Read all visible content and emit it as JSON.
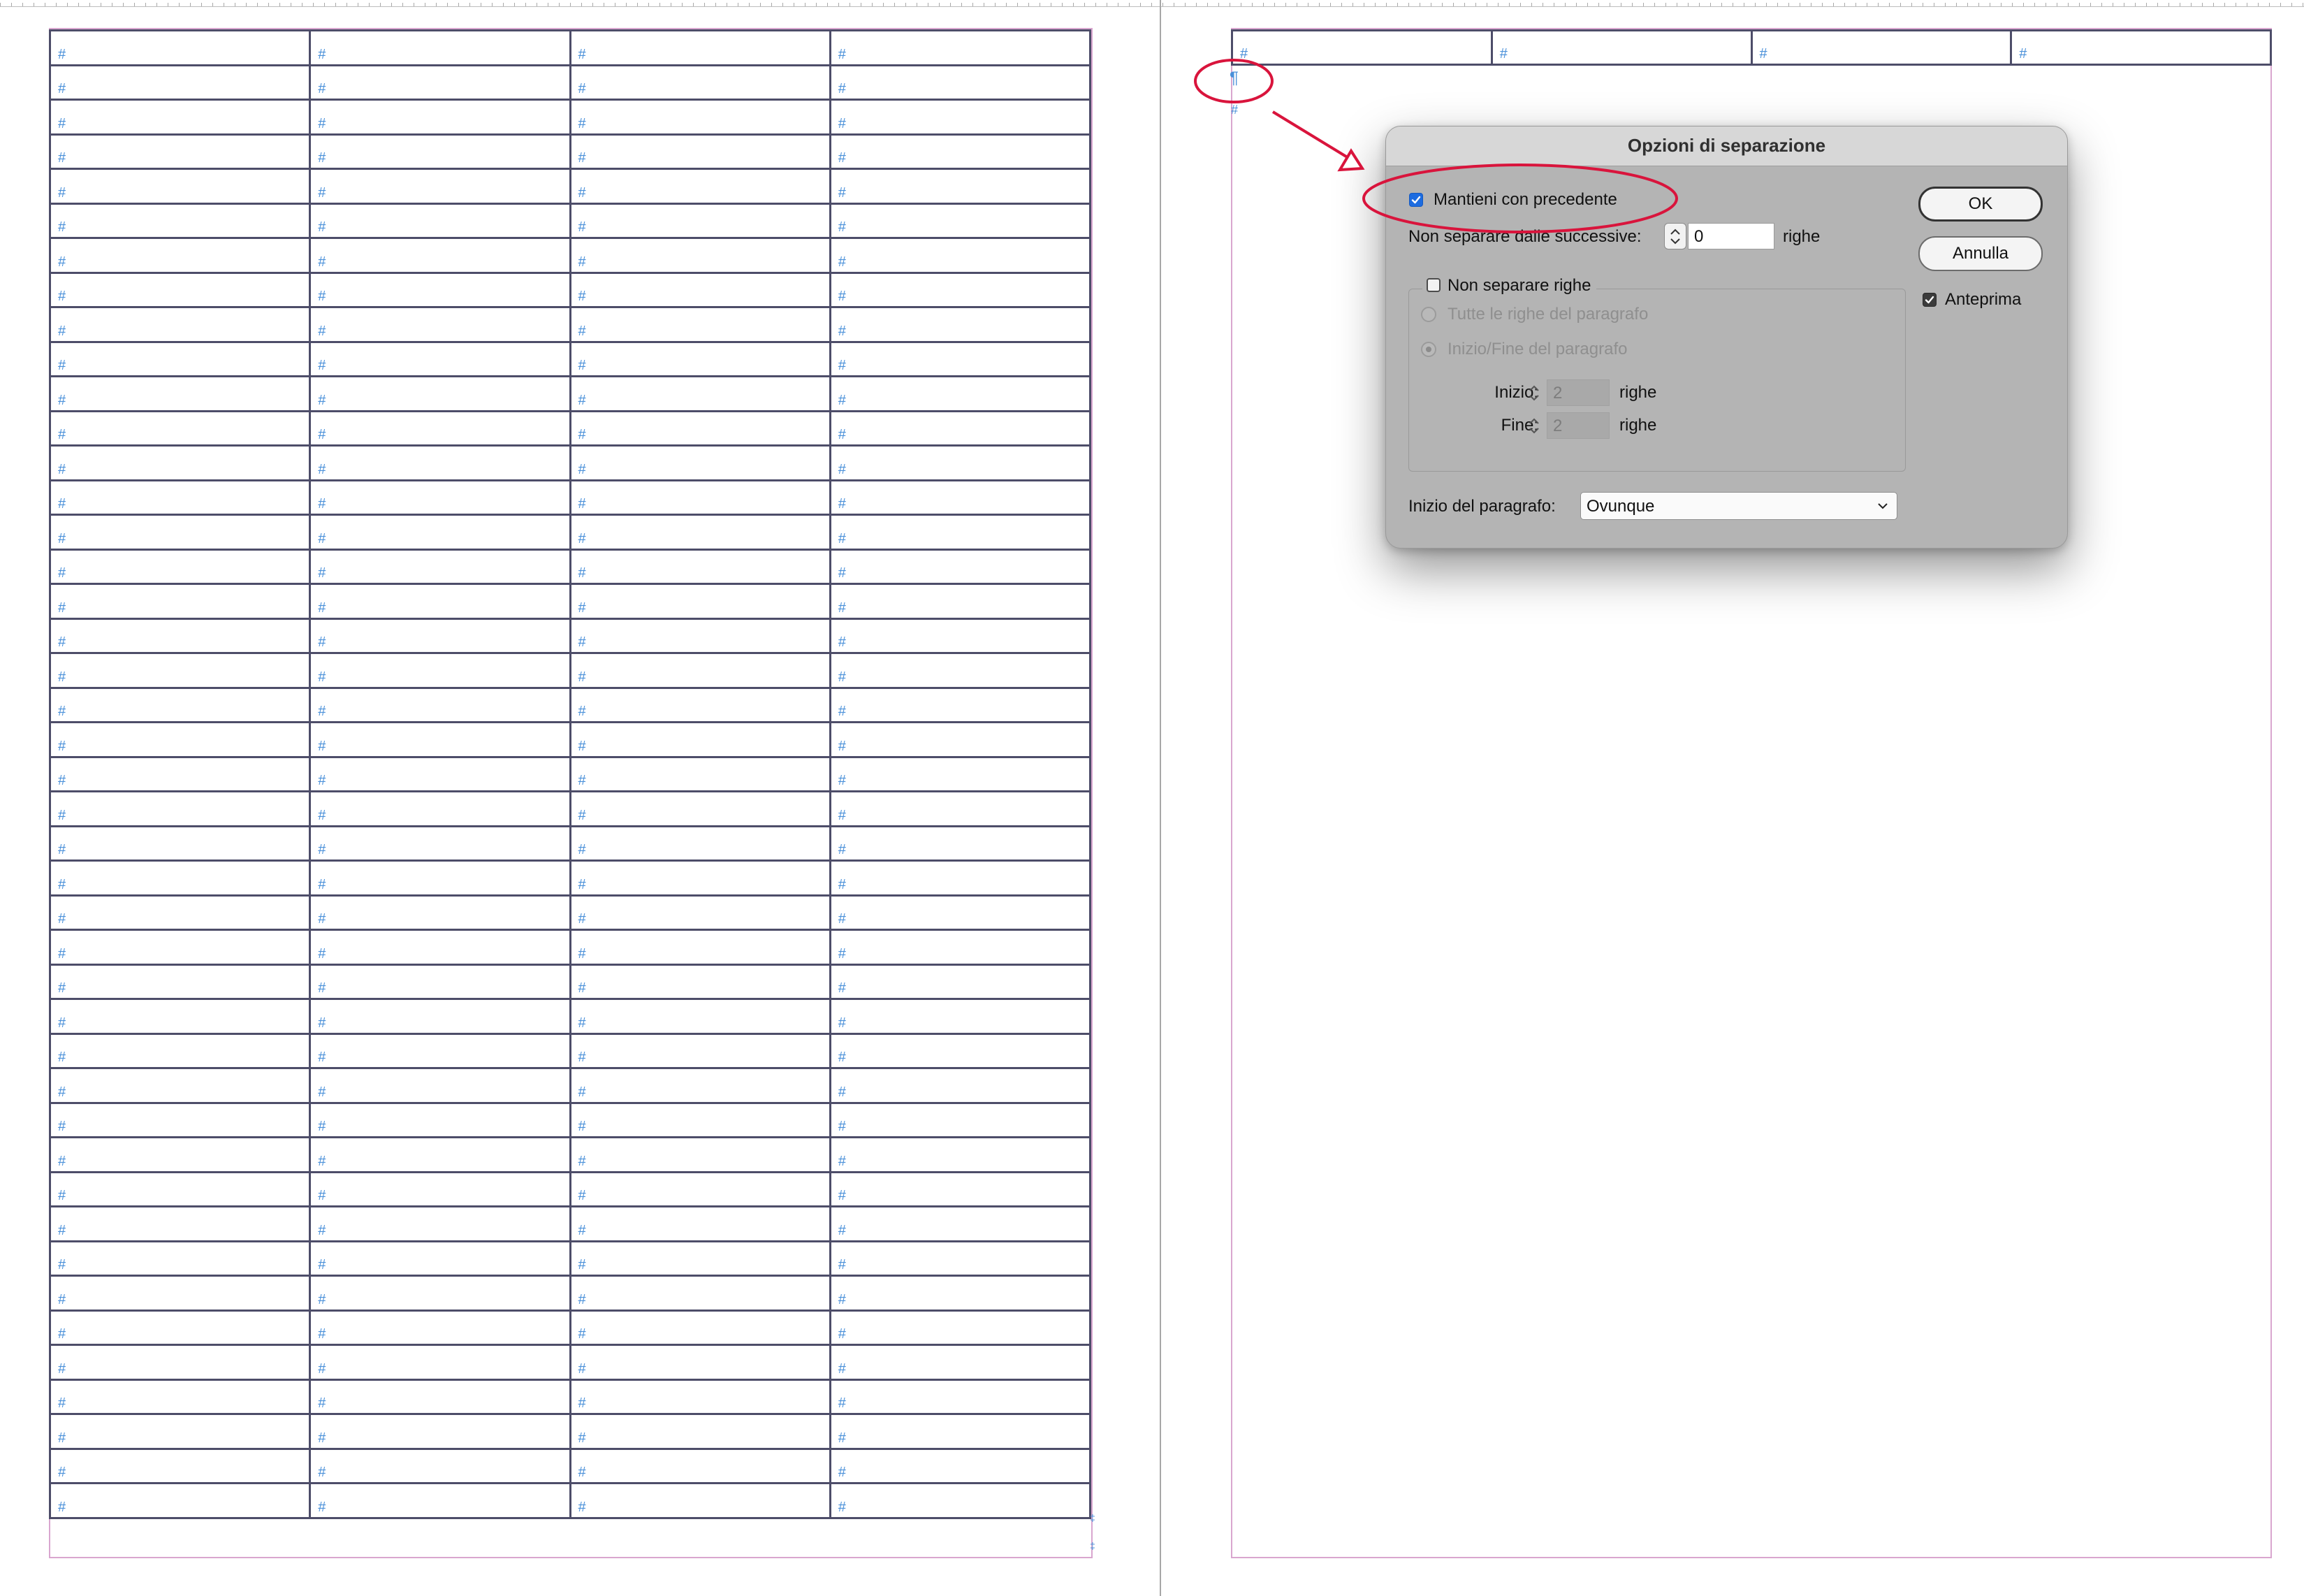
{
  "table_cell_marker": "#",
  "pilcrow": "¶",
  "small_marker": "‡",
  "left_table": {
    "rows": 43,
    "columns": 4
  },
  "right_table": {
    "rows": 1,
    "columns": 4
  },
  "dialog": {
    "title": "Opzioni di separazione",
    "keep_with_previous": {
      "label": "Mantieni con precedente",
      "checked": true
    },
    "keep_with_next": {
      "label": "Non separare dalle successive:",
      "value": "0",
      "unit": "righe"
    },
    "keep_lines_together": {
      "label": "Non separare righe",
      "checked": false
    },
    "all_lines_option": "Tutte le righe del paragrafo",
    "start_end_option": "Inizio/Fine del paragrafo",
    "start": {
      "label": "Inizio:",
      "value": "2",
      "unit": "righe"
    },
    "end": {
      "label": "Fine:",
      "value": "2",
      "unit": "righe"
    },
    "paragraph_start": {
      "label": "Inizio del paragrafo:",
      "value": "Ovunque"
    },
    "ok_label": "OK",
    "cancel_label": "Annulla",
    "preview": {
      "label": "Anteprima",
      "checked": true
    }
  },
  "colors": {
    "marker_blue": "#4a90d9",
    "table_border": "#4d4d69",
    "margin_guide": "#d9a6cf",
    "annotation_red": "#d9143c",
    "checkbox_blue": "#1d6ce0"
  }
}
